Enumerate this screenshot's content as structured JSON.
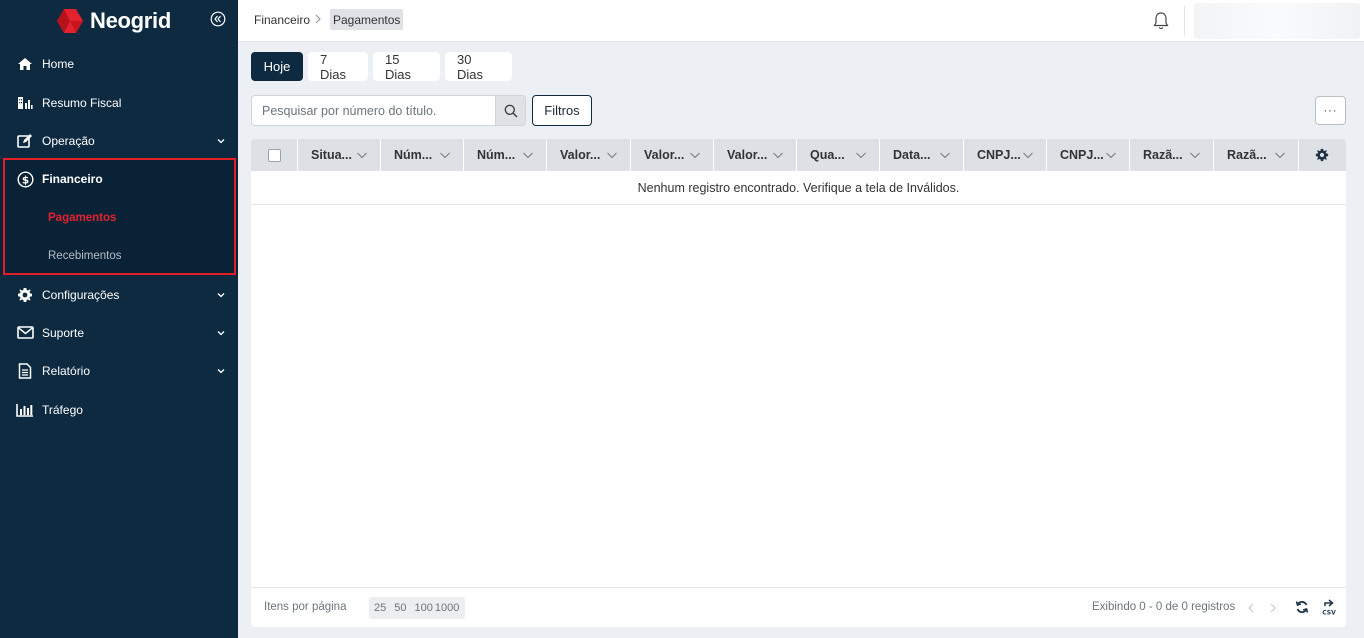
{
  "app": {
    "brand": "Neogrid",
    "brand_color": "#e4222f",
    "sidebar_bg": "#0e2a40"
  },
  "sidebar": {
    "items": [
      {
        "label": "Home",
        "icon": "home-icon"
      },
      {
        "label": "Resumo Fiscal",
        "icon": "building-chart-icon"
      },
      {
        "label": "Operação",
        "icon": "edit-icon",
        "expandable": true
      },
      {
        "label": "Financeiro",
        "icon": "dollar-circle-icon",
        "expanded": true
      },
      {
        "label": "Configurações",
        "icon": "gear-icon",
        "expandable": true
      },
      {
        "label": "Suporte",
        "icon": "envelope-icon",
        "expandable": true
      },
      {
        "label": "Relatório",
        "icon": "document-icon",
        "expandable": true
      },
      {
        "label": "Tráfego",
        "icon": "bar-chart-icon"
      }
    ],
    "financeiro_sub": [
      {
        "label": "Pagamentos",
        "selected": true
      },
      {
        "label": "Recebimentos",
        "selected": false
      }
    ]
  },
  "breadcrumb": {
    "parent": "Financeiro",
    "current": "Pagamentos"
  },
  "tabs": [
    {
      "label": "Hoje",
      "active": true
    },
    {
      "label": "7 Dias",
      "active": false
    },
    {
      "label": "15 Dias",
      "active": false
    },
    {
      "label": "30 Dias",
      "active": false
    }
  ],
  "search": {
    "placeholder": "Pesquisar por número do título.",
    "value": ""
  },
  "filters_label": "Filtros",
  "more_label": "···",
  "grid": {
    "columns": [
      "Situa...",
      "Núm...",
      "Núm...",
      "Valor...",
      "Valor...",
      "Valor...",
      "Qua...",
      "Data...",
      "CNPJ...",
      "CNPJ...",
      "Razã...",
      "Razã..."
    ],
    "empty_message": "Nenhum registro encontrado. Verifique a tela de Inválidos."
  },
  "footer": {
    "items_per_page_label": "Itens por página",
    "page_sizes": [
      "25",
      "50",
      "100",
      "1000"
    ],
    "showing": "Exibindo  0 - 0 de 0 registros"
  }
}
